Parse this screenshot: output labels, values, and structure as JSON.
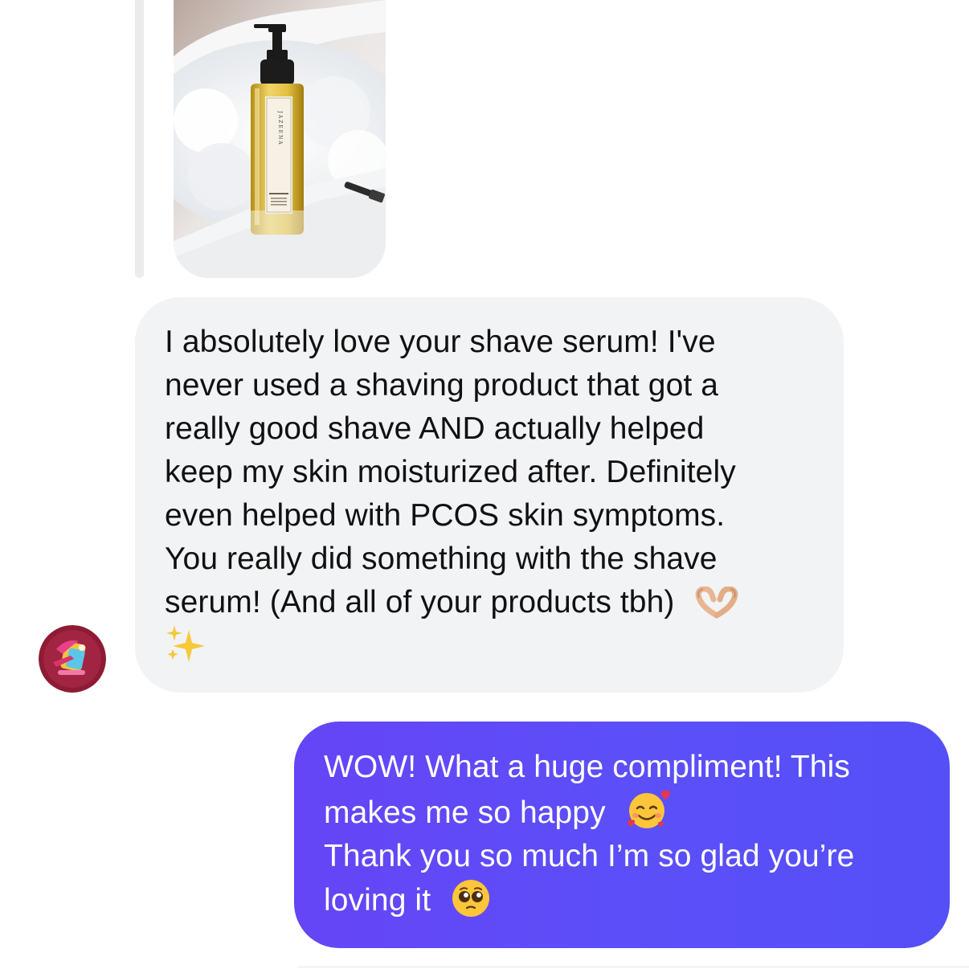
{
  "thread": {
    "shared_image": {
      "brand_text": "JAZEENA",
      "product_text": "Shave Serum",
      "icon": "product-photo"
    },
    "incoming": {
      "lines": [
        "I absolutely love your shave serum! I've",
        "never used a shaving product that got a",
        "really good shave AND actually helped",
        "keep my skin moisturized after. Definitely",
        "even helped with PCOS skin symptoms.",
        "You really did something with the shave",
        "serum! (And all of your products tbh)",
        ""
      ],
      "emojis": [
        "heart-hands-emoji",
        "sparkles-emoji"
      ],
      "avatar_icon": "avatar-icon",
      "bubble_color": "#f2f3f5"
    },
    "outgoing": {
      "lines": [
        "WOW! What a huge compliment! This",
        "makes me so happy",
        "Thank you so much I’m so glad you’re",
        "loving it"
      ],
      "emojis": [
        "smiling-face-with-hearts-emoji",
        "pleading-face-emoji"
      ],
      "bubble_color": "#5b4ff8"
    }
  }
}
